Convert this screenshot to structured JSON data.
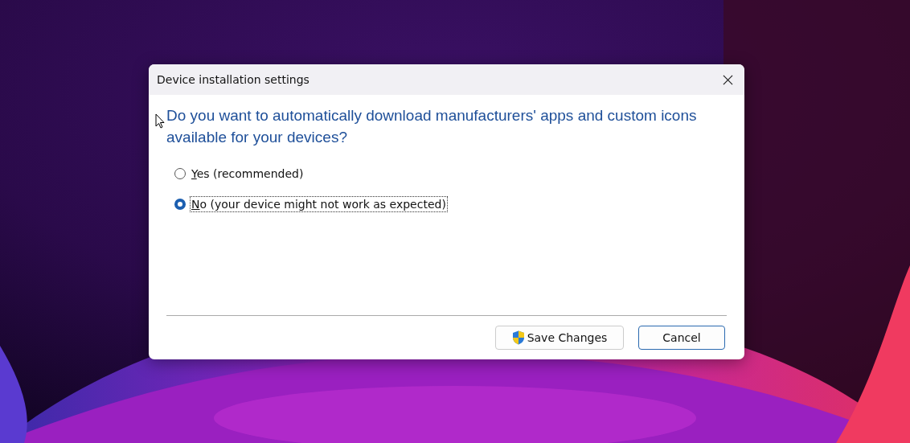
{
  "window": {
    "title": "Device installation settings"
  },
  "question": "Do you want to automatically download manufacturers' apps and custom icons available for your devices?",
  "options": [
    {
      "label": "Yes (recommended)",
      "selected": false
    },
    {
      "label": "No (your device might not work as expected)",
      "selected": true
    }
  ],
  "buttons": [
    {
      "label": "Save Changes",
      "kind": "shield"
    },
    {
      "label": "Cancel",
      "kind": "default"
    }
  ]
}
